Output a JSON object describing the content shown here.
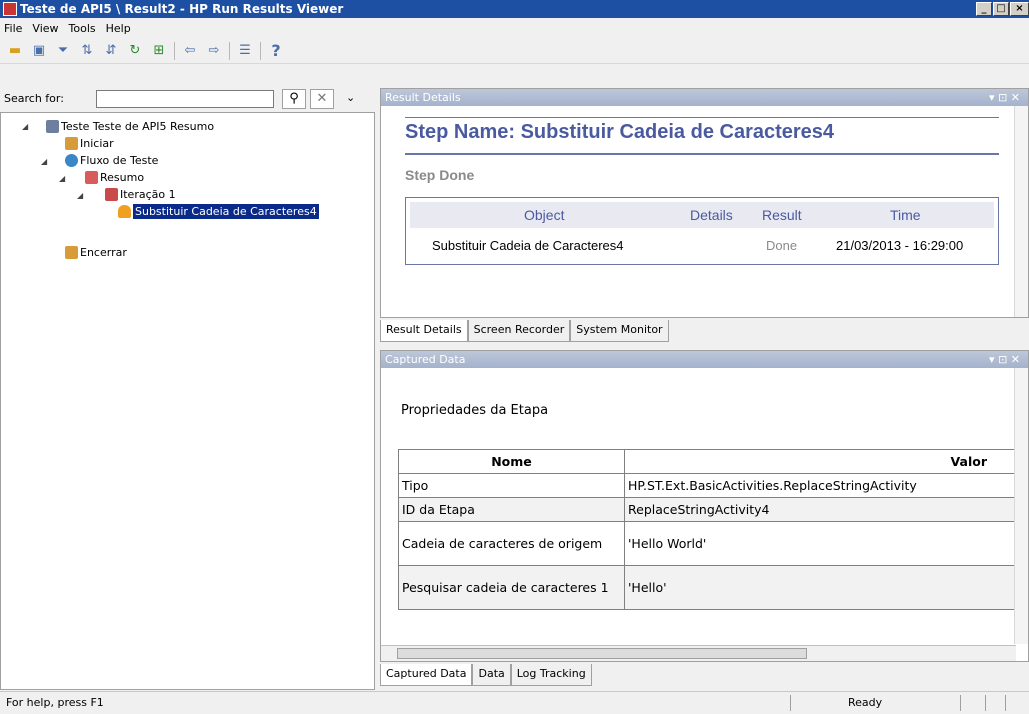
{
  "window": {
    "title": "Teste de API5 \\ Result2 - HP Run Results Viewer",
    "min": "_",
    "max": "□",
    "close": "×"
  },
  "menu": [
    "File",
    "View",
    "Tools",
    "Help"
  ],
  "search": {
    "label": "Search for:",
    "value": "",
    "placeholder": ""
  },
  "tree": {
    "root": "Teste Teste de API5 Resumo",
    "start": "Iniciar",
    "flow": "Fluxo de Teste",
    "summary": "Resumo",
    "iteration": "Iteração 1",
    "step": "Substituir Cadeia de Caracteres4",
    "end": "Encerrar"
  },
  "result_details": {
    "header": "Result Details",
    "step_name": "Step Name: Substituir Cadeia de Caracteres4",
    "step_status": "Step Done",
    "columns": [
      "Object",
      "Details",
      "Result",
      "Time"
    ],
    "row": {
      "object": "Substituir Cadeia de Caracteres4",
      "details": "",
      "result": "Done",
      "time": "21/03/2013 - 16:29:00"
    }
  },
  "mid_tabs": [
    "Result Details",
    "Screen Recorder",
    "System Monitor"
  ],
  "captured": {
    "header": "Captured Data",
    "section_title": "Propriedades da Etapa",
    "columns": [
      "Nome",
      "Valor"
    ],
    "rows": [
      {
        "name": "Tipo",
        "value": "HP.ST.Ext.BasicActivities.ReplaceStringActivity"
      },
      {
        "name": "ID da Etapa",
        "value": "ReplaceStringActivity4"
      },
      {
        "name": "Cadeia de caracteres de origem",
        "value": "'Hello World'"
      },
      {
        "name": "Pesquisar cadeia de caracteres 1",
        "value": "'Hello'"
      }
    ]
  },
  "bottom_tabs": [
    "Captured Data",
    "Data",
    "Log Tracking"
  ],
  "status": {
    "help": "For help, press F1",
    "state": "Ready"
  },
  "colors": {
    "title_blue": "#1d4fa3",
    "heading_blue": "#4a5aa0",
    "pane_header": "#a4b2cc",
    "selection": "#0a2a8a"
  }
}
